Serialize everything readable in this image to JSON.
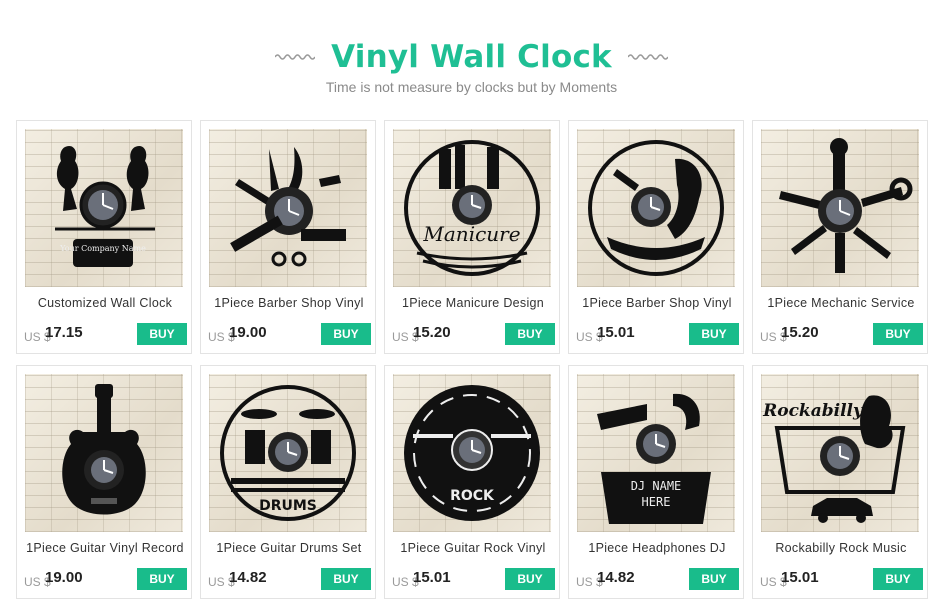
{
  "header": {
    "title": "Vinyl Wall Clock",
    "subtitle": "Time is not measure by clocks but by Moments",
    "accent_color": "#1fbf94"
  },
  "products": [
    {
      "title": "Customized Wall Clock",
      "currency": "US $",
      "price": "17.15",
      "button": "BUY",
      "image": "women-silhouette-clock",
      "image_text": "Your Company Name"
    },
    {
      "title": "1Piece Barber Shop Vinyl",
      "currency": "US $",
      "price": "19.00",
      "button": "BUY",
      "image": "barber-tools-clock"
    },
    {
      "title": "1Piece Manicure Design",
      "currency": "US $",
      "price": "15.20",
      "button": "BUY",
      "image": "manicure-clock",
      "image_text": "Manicure"
    },
    {
      "title": "1Piece Barber Shop Vinyl",
      "currency": "US $",
      "price": "15.01",
      "button": "BUY",
      "image": "bearded-barber-clock"
    },
    {
      "title": "1Piece Mechanic Service",
      "currency": "US $",
      "price": "15.20",
      "button": "BUY",
      "image": "mechanic-tools-clock"
    },
    {
      "title": "1Piece Guitar Vinyl Record",
      "currency": "US $",
      "price": "19.00",
      "button": "BUY",
      "image": "electric-guitar-clock"
    },
    {
      "title": "1Piece Guitar Drums Set",
      "currency": "US $",
      "price": "14.82",
      "button": "BUY",
      "image": "drums-clock",
      "image_text": "DRUMS"
    },
    {
      "title": "1Piece Guitar Rock Vinyl",
      "currency": "US $",
      "price": "15.01",
      "button": "BUY",
      "image": "rock-guitars-clock",
      "image_text": "ROCK"
    },
    {
      "title": "1Piece Headphones DJ",
      "currency": "US $",
      "price": "14.82",
      "button": "BUY",
      "image": "dj-headphones-clock",
      "image_text": "DJ NAME HERE"
    },
    {
      "title": "Rockabilly Rock Music",
      "currency": "US $",
      "price": "15.01",
      "button": "BUY",
      "image": "rockabilly-clock",
      "image_text": "Rockabilly"
    }
  ],
  "colors": {
    "buy_button": "#19bc8b",
    "card_border": "#e3e3e3"
  }
}
